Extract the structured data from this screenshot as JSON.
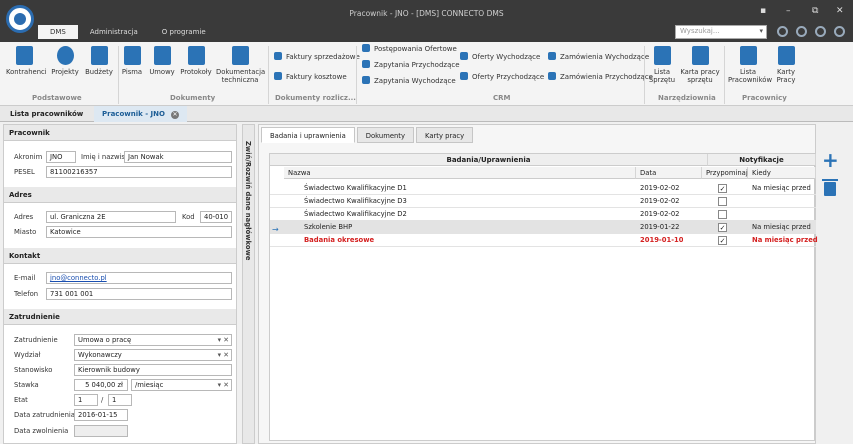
{
  "app": {
    "title": "Pracownik - JNO - [DMS] CONNECTO DMS"
  },
  "menu": {
    "tabs": [
      "DMS",
      "Administracja",
      "O programie"
    ],
    "search_placeholder": "Wyszukaj..."
  },
  "ribbon": {
    "podstawowe": [
      "Kontrahenci",
      "Projekty",
      "Budżety"
    ],
    "dokumenty": [
      "Pisma",
      "Umowy",
      "Protokoły",
      "Dokumentacja techniczna"
    ],
    "rozlicz": [
      "Faktury sprzedażowe",
      "Faktury kosztowe"
    ],
    "crm_col1": [
      "Postępowania Ofertowe",
      "Zapytania Przychodzące",
      "Zapytania Wychodzące"
    ],
    "crm_col2": [
      "Oferty Wychodzące",
      "Oferty Przychodzące"
    ],
    "crm_col3": [
      "Zamówienia Wychodzące",
      "Zamówienia Przychodzące"
    ],
    "narzedziownia": [
      "Lista Sprzętu",
      "Karta pracy sprzętu"
    ],
    "pracownicy": [
      "Lista Pracowników",
      "Karty Pracy"
    ],
    "groups": {
      "podstawowe": "Podstawowe",
      "dokumenty": "Dokumenty",
      "rozlicz": "Dokumenty rozlicz...",
      "crm": "CRM",
      "narzedziownia": "Narzędziownia",
      "pracownicy": "Pracownicy"
    }
  },
  "doc_tabs": {
    "list": "Lista pracowników",
    "active": "Pracownik - JNO"
  },
  "form": {
    "pracownik": {
      "title": "Pracownik",
      "akronim_label": "Akronim",
      "akronim": "JNO",
      "imie_label": "Imię i nazwisko",
      "imie": "Jan Nowak",
      "pesel_label": "PESEL",
      "pesel": "81100216357"
    },
    "adres": {
      "title": "Adres",
      "adres_label": "Adres",
      "adres": "ul. Graniczna  2E",
      "kod_label": "Kod",
      "kod": "40-010",
      "miasto_label": "Miasto",
      "miasto": "Katowice"
    },
    "kontakt": {
      "title": "Kontakt",
      "email_label": "E-mail",
      "email": "jno@connecto.pl",
      "telefon_label": "Telefon",
      "telefon": "731 001 001"
    },
    "zatrudnienie": {
      "title": "Zatrudnienie",
      "zatr_label": "Zatrudnienie",
      "zatr": "Umowa o pracę",
      "wydzial_label": "Wydział",
      "wydzial": "Wykonawczy",
      "stan_label": "Stanowisko",
      "stan": "Kierownik budowy",
      "stawka_label": "Stawka",
      "stawka": "5 040,00 zł",
      "stawka_unit": "/miesiąc",
      "etat_label": "Etat",
      "etat_a": "1",
      "etat_sep": "/",
      "etat_b": "1",
      "data_zatr_label": "Data zatrudnienia",
      "data_zatr": "2016-01-15",
      "data_zwol_label": "Data zwolnienia"
    }
  },
  "vertical_label": "Zwiń/Rozwiń dane nagłówkowe",
  "sub_tabs": [
    "Badania i uprawnienia",
    "Dokumenty",
    "Karty pracy"
  ],
  "grid": {
    "group1": "Badania/Uprawnienia",
    "group2": "Notyfikacje",
    "columns": [
      "Nazwa",
      "Data",
      "Przypominaj",
      "Kiedy"
    ],
    "rows": [
      {
        "nazwa": "Świadectwo Kwalifikacyjne D1",
        "data": "2019-02-02",
        "check": "✓",
        "kiedy": "Na miesiąc przed"
      },
      {
        "nazwa": "Świadectwo Kwalifikacyjne D3",
        "data": "2019-02-02",
        "check": "",
        "kiedy": ""
      },
      {
        "nazwa": "Świadectwo Kwalifikacyjne D2",
        "data": "2019-02-02",
        "check": "",
        "kiedy": ""
      },
      {
        "nazwa": "Szkolenie BHP",
        "data": "2019-01-22",
        "check": "✓",
        "kiedy": "Na miesiąc przed"
      },
      {
        "nazwa": "Badania okresowe",
        "data": "2019-01-10",
        "check": "✓",
        "kiedy": "Na miesiąc przed"
      }
    ]
  }
}
